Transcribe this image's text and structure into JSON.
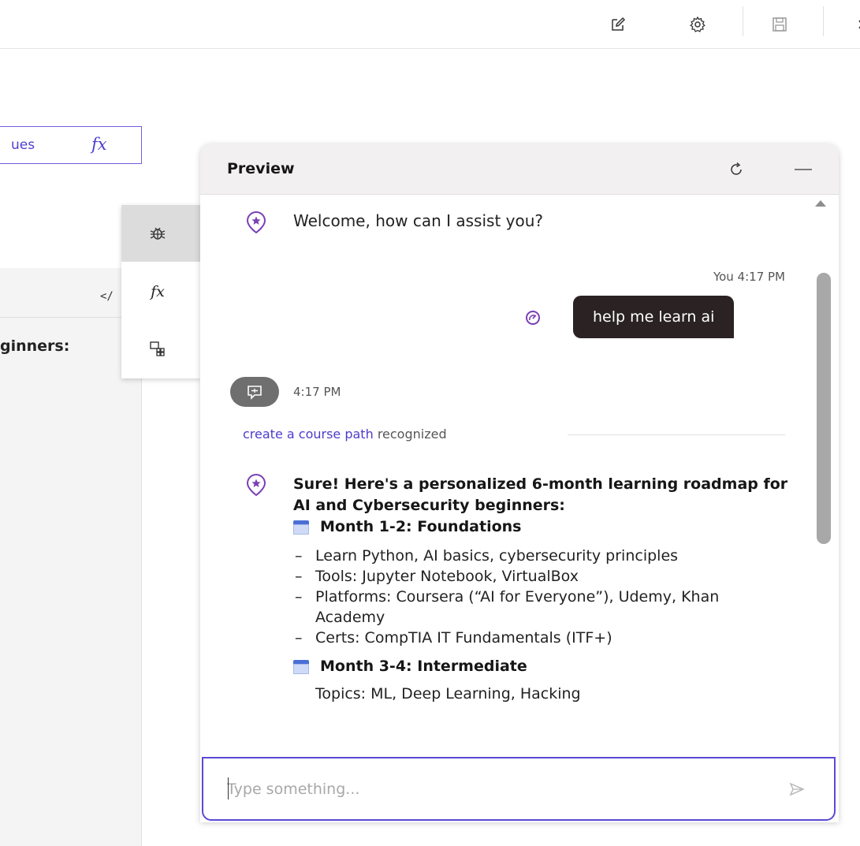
{
  "toolbar": {
    "icons": [
      "edit-icon",
      "settings-icon",
      "save-icon",
      "close-icon"
    ]
  },
  "editor": {
    "values_label": "ues",
    "fx_label": "fx",
    "code_tag": "</",
    "partial_text": "ginners:"
  },
  "side_menu": {
    "items": [
      {
        "icon": "debug-icon",
        "active": true
      },
      {
        "icon": "function-icon",
        "label": "fx"
      },
      {
        "icon": "variables-icon"
      }
    ]
  },
  "preview": {
    "title": "Preview",
    "welcome_message": "Welcome, how can I assist you?",
    "user_meta": "You 4:17 PM",
    "user_message": "help me learn ai",
    "system_time": "4:17 PM",
    "intent": {
      "name": "create a course path",
      "status": "recognized"
    },
    "answer": {
      "intro": "Sure! Here's a personalized 6-month learning roadmap for AI and Cybersecurity beginners:",
      "sections": [
        {
          "heading": "Month 1-2: Foundations",
          "bullets": [
            "Learn Python, AI basics, cybersecurity principles",
            "Tools: Jupyter Notebook, VirtualBox",
            "Platforms: Coursera (“AI for Everyone”), Udemy, Khan Academy",
            "Certs: CompTIA IT Fundamentals (ITF+)"
          ]
        },
        {
          "heading": "Month 3-4: Intermediate",
          "partial_bullet": "Topics: ML, Deep Learning, Hacking"
        }
      ]
    },
    "input": {
      "value": "",
      "placeholder": "Type something..."
    }
  },
  "colors": {
    "accent": "#5b49d6",
    "link": "#4b3ccc",
    "bot_avatar": "#7a3fb5",
    "user_bubble": "#2a2223"
  }
}
